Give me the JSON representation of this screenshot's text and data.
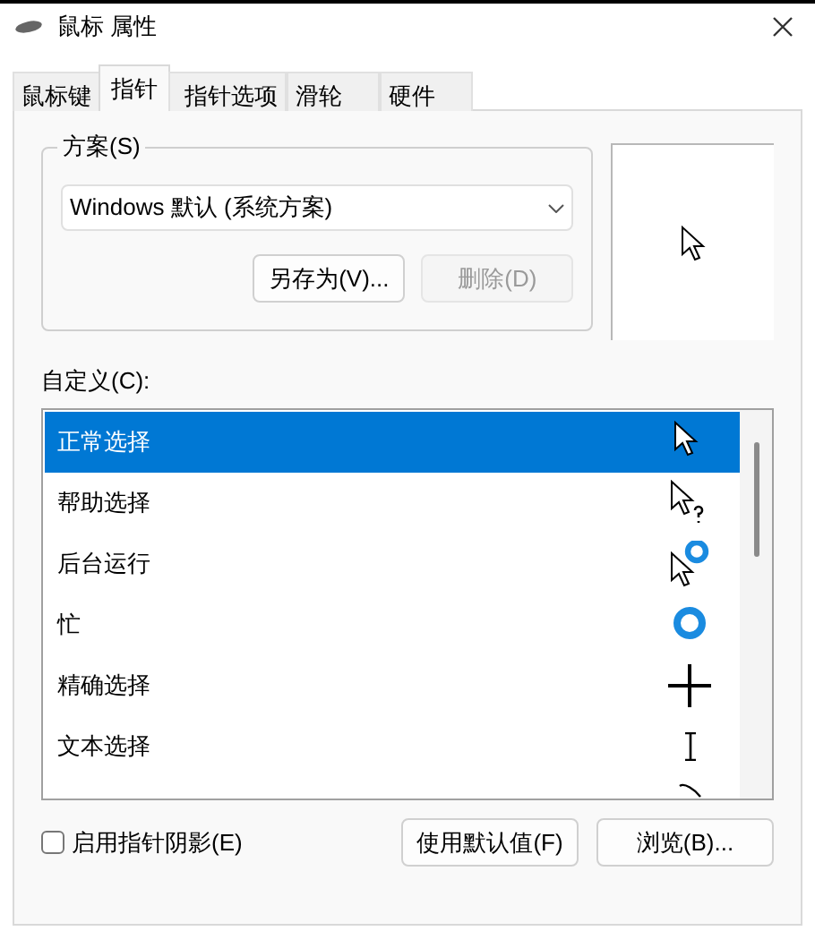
{
  "window": {
    "title": "鼠标 属性"
  },
  "tabs": [
    {
      "label": "鼠标键",
      "selected": false
    },
    {
      "label": "指针",
      "selected": true
    },
    {
      "label": "指针选项",
      "selected": false
    },
    {
      "label": "滑轮",
      "selected": false
    },
    {
      "label": "硬件",
      "selected": false
    }
  ],
  "scheme": {
    "label": "方案(S)",
    "value": "Windows 默认 (系统方案)",
    "buttons": [
      {
        "label": "另存为(V)...",
        "disabled": false
      },
      {
        "label": "删除(D)",
        "disabled": true
      }
    ]
  },
  "customize": {
    "label": "自定义(C):",
    "items": [
      {
        "label": "正常选择",
        "kind": "arrow",
        "selected": true
      },
      {
        "label": "帮助选择",
        "kind": "help",
        "selected": false
      },
      {
        "label": "后台运行",
        "kind": "working",
        "selected": false
      },
      {
        "label": "忙",
        "kind": "busy",
        "selected": false
      },
      {
        "label": "精确选择",
        "kind": "cross",
        "selected": false
      },
      {
        "label": "文本选择",
        "kind": "ibeam",
        "selected": false
      },
      {
        "kind": "pen",
        "selected": false
      }
    ]
  },
  "shadow": {
    "label": "启用指针阴影(E)",
    "checked": false
  },
  "buttons": [
    {
      "label": "使用默认值(F)"
    },
    {
      "label": "浏览(B)..."
    }
  ]
}
